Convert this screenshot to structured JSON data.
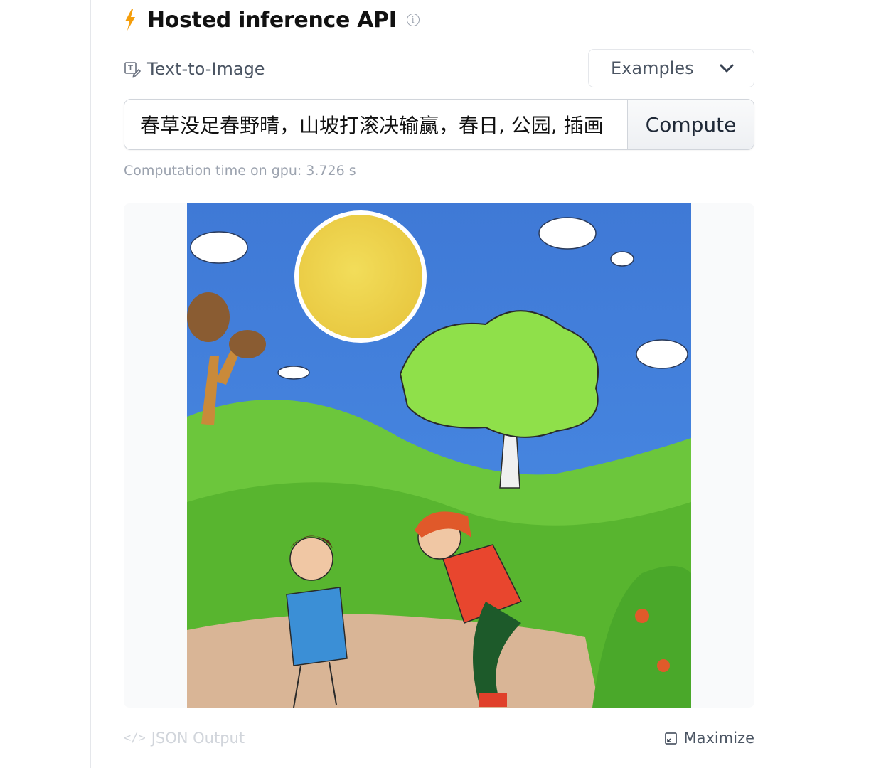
{
  "header": {
    "title": "Hosted inference API",
    "info_icon": "info-icon",
    "bolt_color": "#f59e0b"
  },
  "task": {
    "label": "Text-to-Image",
    "icon": "text-to-image-icon"
  },
  "examples": {
    "label": "Examples",
    "icon": "chevron-down-icon"
  },
  "prompt": {
    "value": "春草没足春野晴，山坡打滚决输赢，春日, 公园, 插画"
  },
  "compute": {
    "label": "Compute"
  },
  "computation_time": "Computation time on gpu: 3.726 s",
  "output": {
    "image": "generated-image"
  },
  "footer": {
    "json_output_label": "JSON Output",
    "maximize_label": "Maximize"
  }
}
